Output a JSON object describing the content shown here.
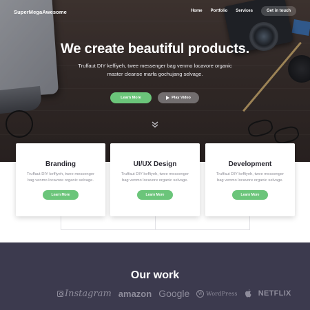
{
  "brand": "SuperMegaAwesome",
  "nav": {
    "items": [
      "Home",
      "Portfolio",
      "Services"
    ],
    "cta": "Get in touch"
  },
  "hero": {
    "title": "We create beautiful products.",
    "subtitle": "Truffaut DIY keffiyeh, twee messenger bag venmo locavore organic master cleanse marfa gochujang selvage.",
    "primary_button": "Learn More",
    "secondary_button": "Play Video"
  },
  "services": [
    {
      "title": "Branding",
      "text": "Truffaut DIY keffiyeh, twee messenger bag venmo locavore organic selvage.",
      "button": "Learn More"
    },
    {
      "title": "UI/UX Design",
      "text": "Truffaut DIY keffiyeh, twee messenger bag venmo locavore organic selvage.",
      "button": "Learn More"
    },
    {
      "title": "Development",
      "text": "Truffaut DIY keffiyeh, twee messenger bag venmo locavore organic selvage.",
      "button": "Learn More"
    }
  ],
  "work": {
    "title": "Our work",
    "logos": [
      "Instagram",
      "amazon",
      "Google",
      "WordPress",
      "Apple",
      "NETFLIX"
    ]
  },
  "colors": {
    "accent_green": "#6bc57a",
    "dark_section": "#3c3a4e",
    "heading_text": "#2b2a33",
    "body_text": "#8e8e97"
  }
}
